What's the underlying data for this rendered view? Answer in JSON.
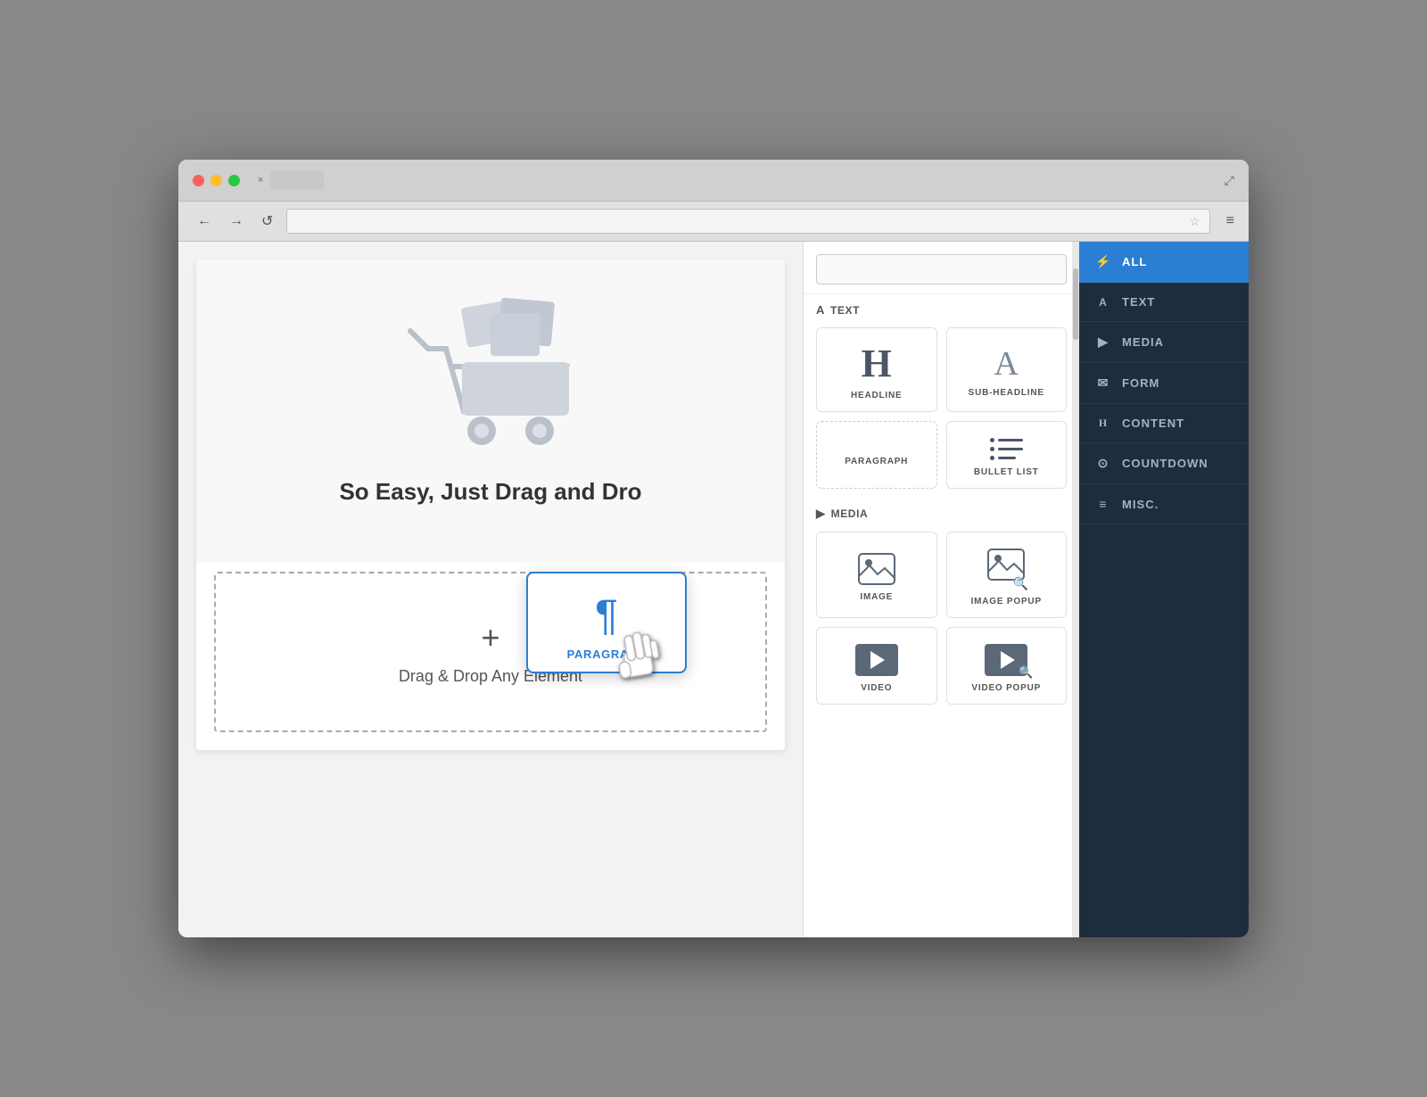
{
  "browser": {
    "nav": {
      "back": "←",
      "forward": "→",
      "refresh": "↺",
      "star": "☆",
      "menu": "≡",
      "expand": "⤢"
    },
    "tab": {
      "close": "×"
    }
  },
  "canvas": {
    "headline": "So Easy, Just Drag and Dro",
    "drop_zone": {
      "plus": "+",
      "label": "Drag & Drop Any Element"
    },
    "paragraph_widget": {
      "icon": "¶",
      "label": "PARAGRAPH"
    }
  },
  "widgets_panel": {
    "search_placeholder": "",
    "sections": {
      "text": {
        "icon": "A",
        "label": "TEXT"
      },
      "media": {
        "icon": "▶",
        "label": "MEDIA"
      }
    },
    "text_widgets": [
      {
        "id": "headline",
        "icon_type": "H",
        "label": "HEADLINE"
      },
      {
        "id": "sub-headline",
        "icon_type": "A",
        "label": "SUB-HEADLINE"
      },
      {
        "id": "paragraph",
        "icon_type": "para",
        "label": "PARAGRAPH"
      },
      {
        "id": "bullet-list",
        "icon_type": "bullets",
        "label": "BULLET LIST"
      }
    ],
    "media_widgets": [
      {
        "id": "image",
        "icon_type": "image",
        "label": "IMAGE"
      },
      {
        "id": "image-popup",
        "icon_type": "image-popup",
        "label": "IMAGE POPUP"
      },
      {
        "id": "video",
        "icon_type": "video",
        "label": "VIDEO"
      },
      {
        "id": "video-popup",
        "icon_type": "video-popup",
        "label": "VIDEO POPUP"
      }
    ]
  },
  "category_nav": {
    "items": [
      {
        "id": "all",
        "icon": "⚡",
        "label": "ALL",
        "active": true
      },
      {
        "id": "text",
        "icon": "A",
        "label": "TEXT",
        "active": false
      },
      {
        "id": "media",
        "icon": "▶",
        "label": "MEDIA",
        "active": false
      },
      {
        "id": "form",
        "icon": "✉",
        "label": "FORM",
        "active": false
      },
      {
        "id": "content",
        "icon": "H",
        "label": "CONTENT",
        "active": false
      },
      {
        "id": "countdown",
        "icon": "⊙",
        "label": "COUNTDOWN",
        "active": false
      },
      {
        "id": "misc",
        "icon": "≡",
        "label": "MISC.",
        "active": false
      }
    ]
  }
}
